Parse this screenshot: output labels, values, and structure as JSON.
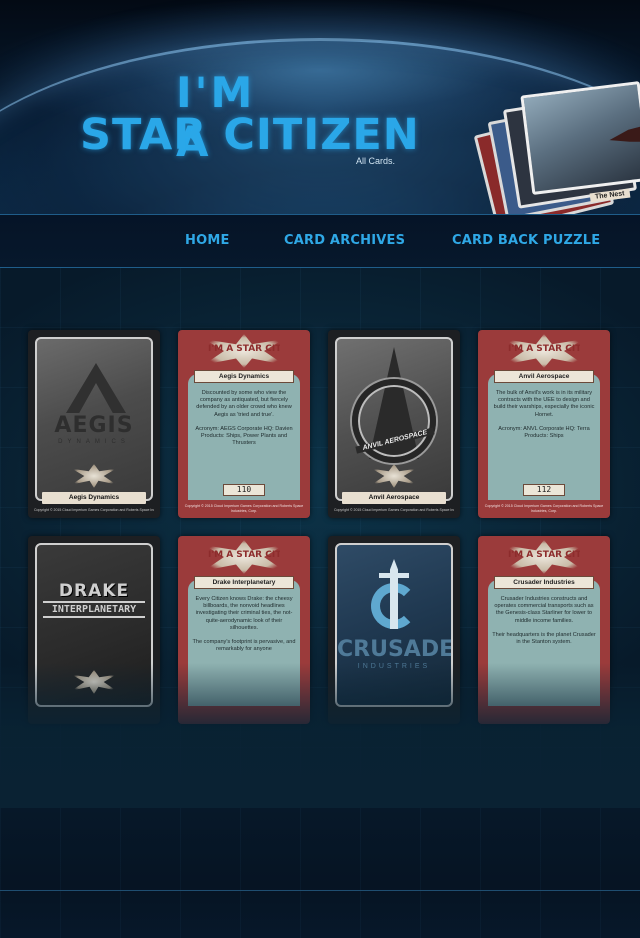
{
  "header": {
    "title_line1": "I'M A",
    "title_line2": "STAR CITIZEN",
    "tagline": "All Cards.",
    "stack_caption": "The Nest"
  },
  "nav": {
    "items": [
      {
        "label": "HOME"
      },
      {
        "label": "CARD ARCHIVES"
      },
      {
        "label": "CARD BACK PUZZLE"
      }
    ]
  },
  "seal_text": "I'M A STAR CITIZEN",
  "cards": {
    "aegis_front": {
      "logo": "AEGIS",
      "logo_sub": "DYNAMICS",
      "name": "Aegis Dynamics",
      "copyright": "Copyright © 2015 Cloud Imperium Games Corporation and Roberts Space Industries, Corp."
    },
    "aegis_back": {
      "name": "Aegis Dynamics",
      "description": "Discounted by some who view the company as antiquated, but fiercely defended by an older crowd who knew Aegis as 'tried and true'.",
      "details": "Acronym: AEGS Corporate HQ: Davien Products: Ships, Power Plants and Thrusters",
      "number": "110",
      "copyright": "Copyright © 2015 Cloud Imperium Games Corporation and Roberts Space Industries, Corp."
    },
    "anvil_front": {
      "logo": "ANVIL AEROSPACE",
      "name": "Anvil Aerospace",
      "copyright": "Copyright © 2015 Cloud Imperium Games Corporation and Roberts Space Industries, Corp."
    },
    "anvil_back": {
      "name": "Anvil Aerospace",
      "description": "The bulk of Anvil's work is in its military contracts with the UEE to design and build their warships, especially the iconic Hornet.",
      "details": "Acronym: ANVL Corporate HQ: Terra Products: Ships",
      "number": "112",
      "copyright": "Copyright © 2015 Cloud Imperium Games Corporation and Roberts Space Industries, Corp."
    },
    "drake_front": {
      "logo1": "DRAKE",
      "logo2": "INTERPLANETARY"
    },
    "drake_back": {
      "name": "Drake Interplanetary",
      "description": "Every Citizen knows Drake: the cheesy billboards, the nonvoid headlines investigating their criminal ties, the not-quite-aerodynamic look of their silhouettes.",
      "details": "The company's footprint is pervasive, and remarkably for anyone"
    },
    "crusader_front": {
      "logo": "CRUSADER",
      "logo_sub": "INDUSTRIES"
    },
    "crusader_back": {
      "name": "Crusader Industries",
      "description": "Crusader Industries constructs and operates commercial transports such as the Genesis-class Starliner for lower to middle income families.",
      "details": "Their headquarters is the planet Crusader in the Stanton system."
    }
  },
  "colors": {
    "accent": "#2aa7e8",
    "card_red": "#9b3b3b",
    "panel_teal": "#8fb2b1",
    "background": "#04101c"
  }
}
